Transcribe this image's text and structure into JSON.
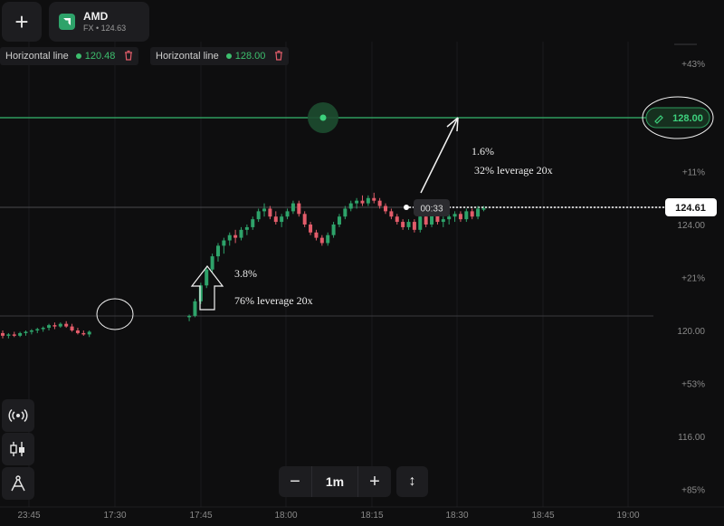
{
  "toolbar": {
    "add_label": "+"
  },
  "asset": {
    "name": "AMD",
    "subtitle": "FX • 124.63"
  },
  "horizontal_lines": [
    {
      "label": "Horizontal line",
      "value": "120.48"
    },
    {
      "label": "Horizontal line",
      "value": "128.00"
    }
  ],
  "price_axis": {
    "ticks": [
      {
        "label": "+43%",
        "price": 128.9
      },
      {
        "label": "+11%",
        "price": 126.0
      },
      {
        "label": "124.00",
        "price": 124.0
      },
      {
        "label": "+21%",
        "price": 122.0
      },
      {
        "label": "120.00",
        "price": 120.0
      },
      {
        "label": "+53%",
        "price": 118.0
      },
      {
        "label": "116.00",
        "price": 116.0
      },
      {
        "label": "+85%",
        "price": 114.0
      }
    ],
    "current_price": "124.61",
    "line_price_tag": "128.00"
  },
  "time_axis": {
    "ticks": [
      "23:45",
      "17:30",
      "17:45",
      "18:00",
      "18:15",
      "18:30",
      "18:45",
      "19:00"
    ]
  },
  "countdown": "00:33",
  "annotations": [
    {
      "text": "1.6%"
    },
    {
      "text": "32% leverage 20x"
    },
    {
      "text": "3.8%"
    },
    {
      "text": "76% leverage 20x"
    }
  ],
  "timeframe": {
    "label": "1m",
    "minus": "−",
    "plus": "+",
    "resize": "↕"
  },
  "colors": {
    "up": "#2ea36a",
    "down": "#e25c6a",
    "line": "#2e9b5e",
    "background": "#0e0e0f"
  },
  "chart_data": {
    "type": "candlestick",
    "price_range": [
      114,
      129
    ],
    "candles": [
      {
        "o": 119.9,
        "h": 120.0,
        "l": 119.7,
        "c": 119.8
      },
      {
        "o": 119.8,
        "h": 119.9,
        "l": 119.7,
        "c": 119.85
      },
      {
        "o": 119.85,
        "h": 119.95,
        "l": 119.75,
        "c": 119.8
      },
      {
        "o": 119.8,
        "h": 119.95,
        "l": 119.75,
        "c": 119.9
      },
      {
        "o": 119.9,
        "h": 120.0,
        "l": 119.8,
        "c": 119.95
      },
      {
        "o": 119.95,
        "h": 120.05,
        "l": 119.85,
        "c": 120.0
      },
      {
        "o": 120.0,
        "h": 120.1,
        "l": 119.9,
        "c": 120.05
      },
      {
        "o": 120.05,
        "h": 120.15,
        "l": 119.95,
        "c": 120.1
      },
      {
        "o": 120.1,
        "h": 120.25,
        "l": 120.0,
        "c": 120.2
      },
      {
        "o": 120.2,
        "h": 120.3,
        "l": 120.05,
        "c": 120.15
      },
      {
        "o": 120.15,
        "h": 120.3,
        "l": 120.1,
        "c": 120.25
      },
      {
        "o": 120.25,
        "h": 120.35,
        "l": 120.1,
        "c": 120.15
      },
      {
        "o": 120.15,
        "h": 120.25,
        "l": 119.95,
        "c": 120.0
      },
      {
        "o": 120.0,
        "h": 120.1,
        "l": 119.85,
        "c": 119.9
      },
      {
        "o": 119.9,
        "h": 120.0,
        "l": 119.8,
        "c": 119.85
      },
      {
        "o": 119.85,
        "h": 120.0,
        "l": 119.75,
        "c": 119.95
      },
      {
        "o": 120.5,
        "h": 120.6,
        "l": 120.35,
        "c": 120.55
      },
      {
        "o": 120.55,
        "h": 121.2,
        "l": 120.5,
        "c": 121.1
      },
      {
        "o": 121.1,
        "h": 121.8,
        "l": 121.0,
        "c": 121.7
      },
      {
        "o": 121.7,
        "h": 122.4,
        "l": 121.6,
        "c": 122.3
      },
      {
        "o": 122.3,
        "h": 122.9,
        "l": 122.2,
        "c": 122.8
      },
      {
        "o": 122.8,
        "h": 123.3,
        "l": 122.6,
        "c": 123.2
      },
      {
        "o": 123.2,
        "h": 123.5,
        "l": 122.9,
        "c": 123.4
      },
      {
        "o": 123.4,
        "h": 123.7,
        "l": 123.2,
        "c": 123.6
      },
      {
        "o": 123.6,
        "h": 123.8,
        "l": 123.3,
        "c": 123.5
      },
      {
        "o": 123.5,
        "h": 123.9,
        "l": 123.4,
        "c": 123.8
      },
      {
        "o": 123.8,
        "h": 124.0,
        "l": 123.6,
        "c": 123.9
      },
      {
        "o": 123.9,
        "h": 124.3,
        "l": 123.8,
        "c": 124.2
      },
      {
        "o": 124.2,
        "h": 124.6,
        "l": 124.1,
        "c": 124.5
      },
      {
        "o": 124.5,
        "h": 124.8,
        "l": 124.3,
        "c": 124.6
      },
      {
        "o": 124.6,
        "h": 124.7,
        "l": 124.2,
        "c": 124.3
      },
      {
        "o": 124.3,
        "h": 124.5,
        "l": 124.0,
        "c": 124.1
      },
      {
        "o": 124.1,
        "h": 124.4,
        "l": 123.9,
        "c": 124.3
      },
      {
        "o": 124.3,
        "h": 124.6,
        "l": 124.2,
        "c": 124.5
      },
      {
        "o": 124.5,
        "h": 124.9,
        "l": 124.4,
        "c": 124.8
      },
      {
        "o": 124.8,
        "h": 124.9,
        "l": 124.3,
        "c": 124.4
      },
      {
        "o": 124.4,
        "h": 124.5,
        "l": 123.9,
        "c": 124.0
      },
      {
        "o": 124.0,
        "h": 124.1,
        "l": 123.6,
        "c": 123.7
      },
      {
        "o": 123.7,
        "h": 123.8,
        "l": 123.4,
        "c": 123.5
      },
      {
        "o": 123.5,
        "h": 123.6,
        "l": 123.2,
        "c": 123.3
      },
      {
        "o": 123.3,
        "h": 123.7,
        "l": 123.2,
        "c": 123.6
      },
      {
        "o": 123.6,
        "h": 124.1,
        "l": 123.5,
        "c": 124.0
      },
      {
        "o": 124.0,
        "h": 124.4,
        "l": 123.9,
        "c": 124.3
      },
      {
        "o": 124.3,
        "h": 124.7,
        "l": 124.2,
        "c": 124.6
      },
      {
        "o": 124.6,
        "h": 124.9,
        "l": 124.5,
        "c": 124.8
      },
      {
        "o": 124.8,
        "h": 125.0,
        "l": 124.6,
        "c": 124.9
      },
      {
        "o": 124.9,
        "h": 125.1,
        "l": 124.7,
        "c": 124.8
      },
      {
        "o": 124.8,
        "h": 125.1,
        "l": 124.7,
        "c": 125.0
      },
      {
        "o": 125.0,
        "h": 125.2,
        "l": 124.8,
        "c": 124.9
      },
      {
        "o": 124.9,
        "h": 125.0,
        "l": 124.6,
        "c": 124.7
      },
      {
        "o": 124.7,
        "h": 124.8,
        "l": 124.4,
        "c": 124.5
      },
      {
        "o": 124.5,
        "h": 124.6,
        "l": 124.2,
        "c": 124.3
      },
      {
        "o": 124.3,
        "h": 124.4,
        "l": 124.0,
        "c": 124.1
      },
      {
        "o": 124.1,
        "h": 124.2,
        "l": 123.8,
        "c": 123.9
      },
      {
        "o": 123.9,
        "h": 124.2,
        "l": 123.8,
        "c": 124.1
      },
      {
        "o": 124.1,
        "h": 124.2,
        "l": 123.7,
        "c": 123.8
      },
      {
        "o": 123.8,
        "h": 124.4,
        "l": 123.7,
        "c": 124.3
      },
      {
        "o": 124.3,
        "h": 124.5,
        "l": 123.9,
        "c": 124.0
      },
      {
        "o": 124.0,
        "h": 124.6,
        "l": 123.9,
        "c": 124.5
      },
      {
        "o": 124.5,
        "h": 124.6,
        "l": 124.0,
        "c": 124.1
      },
      {
        "o": 124.1,
        "h": 124.3,
        "l": 123.9,
        "c": 124.2
      },
      {
        "o": 124.2,
        "h": 124.4,
        "l": 124.0,
        "c": 124.3
      },
      {
        "o": 124.3,
        "h": 124.5,
        "l": 124.1,
        "c": 124.4
      },
      {
        "o": 124.4,
        "h": 124.5,
        "l": 124.1,
        "c": 124.2
      },
      {
        "o": 124.2,
        "h": 124.6,
        "l": 124.1,
        "c": 124.5
      },
      {
        "o": 124.5,
        "h": 124.6,
        "l": 124.2,
        "c": 124.3
      },
      {
        "o": 124.3,
        "h": 124.7,
        "l": 124.2,
        "c": 124.6
      },
      {
        "o": 124.6,
        "h": 124.7,
        "l": 124.5,
        "c": 124.61
      }
    ]
  }
}
